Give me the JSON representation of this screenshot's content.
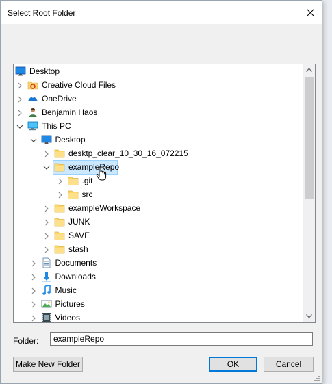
{
  "dialog": {
    "title": "Select Root Folder",
    "close_icon": "close-icon"
  },
  "tree": {
    "items": [
      {
        "label": "Desktop",
        "icon": "desktop-icon",
        "level": 0,
        "expander": "none"
      },
      {
        "label": "Creative Cloud Files",
        "icon": "creative-cloud-icon",
        "level": 1,
        "expander": "collapsed"
      },
      {
        "label": "OneDrive",
        "icon": "onedrive-icon",
        "level": 1,
        "expander": "collapsed"
      },
      {
        "label": "Benjamin Haos",
        "icon": "user-icon",
        "level": 1,
        "expander": "collapsed"
      },
      {
        "label": "This PC",
        "icon": "this-pc-icon",
        "level": 1,
        "expander": "expanded"
      },
      {
        "label": "Desktop",
        "icon": "desktop-icon",
        "level": 2,
        "expander": "expanded"
      },
      {
        "label": "desktp_clear_10_30_16_072215",
        "icon": "folder-icon",
        "level": 3,
        "expander": "collapsed"
      },
      {
        "label": "exampleRepo",
        "icon": "folder-icon",
        "level": 3,
        "expander": "expanded",
        "selected": true
      },
      {
        "label": ".git",
        "icon": "folder-icon",
        "level": 4,
        "expander": "collapsed"
      },
      {
        "label": "src",
        "icon": "folder-icon",
        "level": 4,
        "expander": "collapsed"
      },
      {
        "label": "exampleWorkspace",
        "icon": "folder-icon",
        "level": 3,
        "expander": "collapsed"
      },
      {
        "label": "JUNK",
        "icon": "folder-icon",
        "level": 3,
        "expander": "collapsed"
      },
      {
        "label": "SAVE",
        "icon": "folder-icon",
        "level": 3,
        "expander": "collapsed"
      },
      {
        "label": "stash",
        "icon": "folder-icon",
        "level": 3,
        "expander": "collapsed"
      },
      {
        "label": "Documents",
        "icon": "documents-icon",
        "level": 2,
        "expander": "collapsed"
      },
      {
        "label": "Downloads",
        "icon": "downloads-icon",
        "level": 2,
        "expander": "collapsed"
      },
      {
        "label": "Music",
        "icon": "music-icon",
        "level": 2,
        "expander": "collapsed"
      },
      {
        "label": "Pictures",
        "icon": "pictures-icon",
        "level": 2,
        "expander": "collapsed"
      },
      {
        "label": "Videos",
        "icon": "videos-icon",
        "level": 2,
        "expander": "collapsed"
      }
    ]
  },
  "folder": {
    "label": "Folder:",
    "value": "exampleRepo"
  },
  "buttons": {
    "make_new_folder": "Make New Folder",
    "ok": "OK",
    "cancel": "Cancel"
  },
  "colors": {
    "selection_fill": "#cce8ff",
    "selection_border": "#99d1ff",
    "default_button_border": "#0078d7",
    "folder_yellow": "#ffd766"
  }
}
